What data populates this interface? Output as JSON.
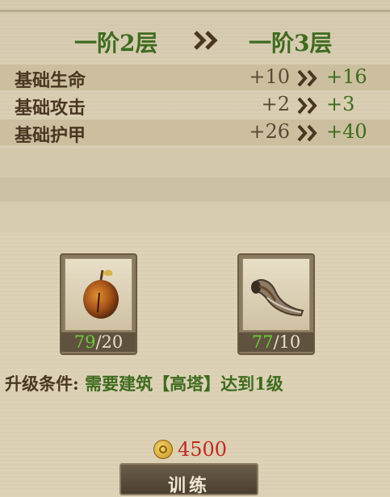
{
  "tier": {
    "from": "一阶2层",
    "to": "一阶3层"
  },
  "stats": [
    {
      "label": "基础生命",
      "from": "+10",
      "to": "+16"
    },
    {
      "label": "基础攻击",
      "from": "+2",
      "to": "+3"
    },
    {
      "label": "基础护甲",
      "from": "+26",
      "to": "+40"
    }
  ],
  "materials": [
    {
      "icon": "apple-icon",
      "have": "79",
      "need": "/20"
    },
    {
      "icon": "horn-icon",
      "have": "77",
      "need": "/10"
    }
  ],
  "condition": {
    "label": "升级条件:",
    "text": "需要建筑【高塔】达到1级"
  },
  "cost": {
    "icon": "gold-coin-icon",
    "value": "4500"
  },
  "train_button": {
    "label": "训练"
  },
  "colors": {
    "accent_green": "#3e6b1f",
    "count_green": "#6ccb3a",
    "cost_red": "#c2281e",
    "panel_bg": "#ddd2b6"
  }
}
